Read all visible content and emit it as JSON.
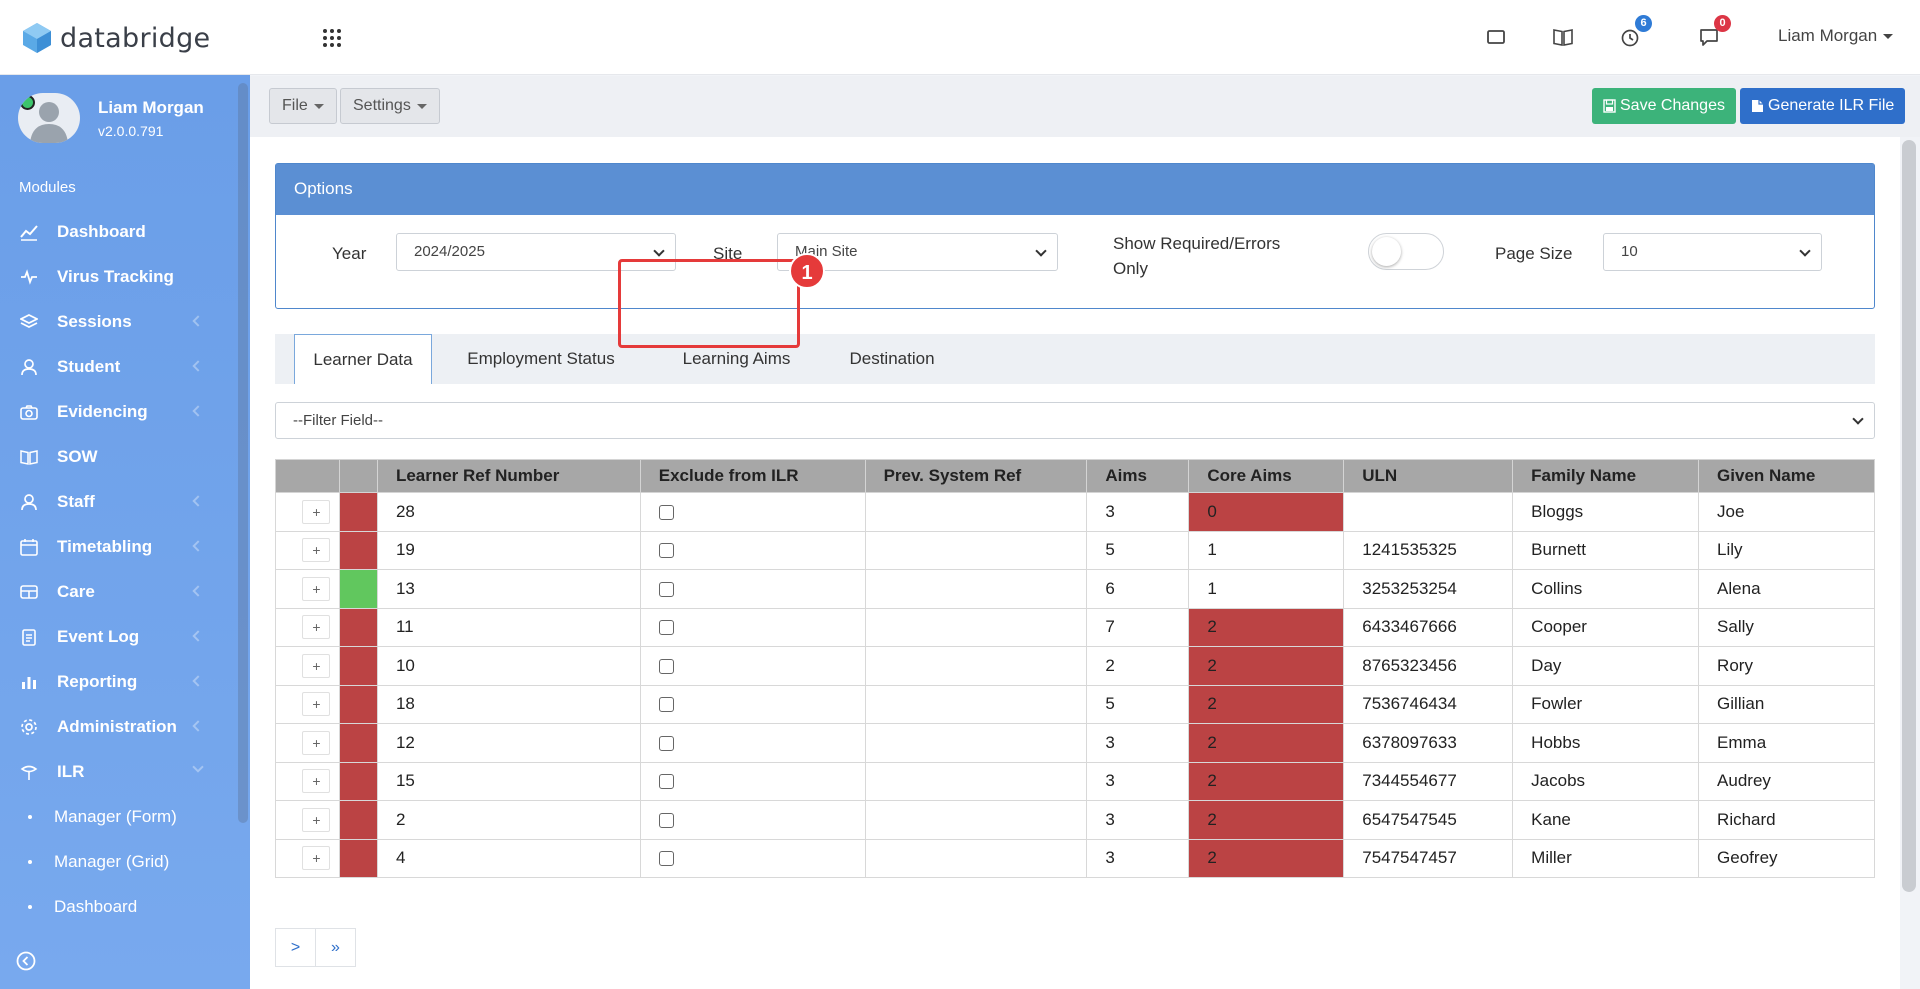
{
  "app": {
    "name": "databridge"
  },
  "header": {
    "user_name": "Liam Morgan",
    "reminders_count": "6",
    "messages_count": "0"
  },
  "sidebar": {
    "profile_name": "Liam Morgan",
    "version": "v2.0.0.791",
    "modules_label": "Modules",
    "items": [
      {
        "label": "Dashboard",
        "icon": "dashboard-chart-icon",
        "has_submenu": false
      },
      {
        "label": "Virus Tracking",
        "icon": "pulse-icon",
        "has_submenu": false
      },
      {
        "label": "Sessions",
        "icon": "layers-icon",
        "has_submenu": true
      },
      {
        "label": "Student",
        "icon": "student-icon",
        "has_submenu": true
      },
      {
        "label": "Evidencing",
        "icon": "camera-icon",
        "has_submenu": true
      },
      {
        "label": "SOW",
        "icon": "book-icon",
        "has_submenu": false
      },
      {
        "label": "Staff",
        "icon": "staff-icon",
        "has_submenu": true
      },
      {
        "label": "Timetabling",
        "icon": "calendar-icon",
        "has_submenu": true
      },
      {
        "label": "Care",
        "icon": "care-icon",
        "has_submenu": true
      },
      {
        "label": "Event Log",
        "icon": "clipboard-icon",
        "has_submenu": true
      },
      {
        "label": "Reporting",
        "icon": "bar-chart-icon",
        "has_submenu": true
      },
      {
        "label": "Administration",
        "icon": "gear-icon",
        "has_submenu": true
      },
      {
        "label": "ILR",
        "icon": "ilr-icon",
        "has_submenu": true
      }
    ],
    "subitems": [
      "Manager (Form)",
      "Manager (Grid)",
      "Dashboard"
    ]
  },
  "toolbar": {
    "file_label": "File",
    "settings_label": "Settings",
    "save_label": "Save Changes",
    "generate_label": "Generate ILR File"
  },
  "options": {
    "title": "Options",
    "year_label": "Year",
    "year_value": "2024/2025",
    "site_label": "Site",
    "site_value": "Main Site",
    "show_required_label_line1": "Show Required/Errors",
    "show_required_label_line2": "Only",
    "show_required_on": false,
    "page_size_label": "Page Size",
    "page_size_value": "10"
  },
  "tabs": [
    {
      "label": "Learner Data",
      "active": true
    },
    {
      "label": "Employment Status",
      "active": false
    },
    {
      "label": "Learning Aims",
      "active": false
    },
    {
      "label": "Destination",
      "active": false
    }
  ],
  "annotation": {
    "step": "1"
  },
  "filter": {
    "placeholder": "--Filter Field--"
  },
  "table": {
    "headers": [
      "",
      "",
      "Learner Ref Number",
      "Exclude from ILR",
      "Prev. System Ref",
      "Aims",
      "Core Aims",
      "ULN",
      "Family Name",
      "Given Name"
    ],
    "rows": [
      {
        "status": "red",
        "ref": "28",
        "prev": "",
        "aims": "3",
        "core": "0",
        "core_flag": true,
        "uln": "",
        "family": "Bloggs",
        "given": "Joe"
      },
      {
        "status": "red",
        "ref": "19",
        "prev": "",
        "aims": "5",
        "core": "1",
        "core_flag": false,
        "uln": "1241535325",
        "family": "Burnett",
        "given": "Lily"
      },
      {
        "status": "green",
        "ref": "13",
        "prev": "",
        "aims": "6",
        "core": "1",
        "core_flag": false,
        "uln": "3253253254",
        "family": "Collins",
        "given": "Alena"
      },
      {
        "status": "red",
        "ref": "11",
        "prev": "",
        "aims": "7",
        "core": "2",
        "core_flag": true,
        "uln": "6433467666",
        "family": "Cooper",
        "given": "Sally"
      },
      {
        "status": "red",
        "ref": "10",
        "prev": "",
        "aims": "2",
        "core": "2",
        "core_flag": true,
        "uln": "8765323456",
        "family": "Day",
        "given": "Rory"
      },
      {
        "status": "red",
        "ref": "18",
        "prev": "",
        "aims": "5",
        "core": "2",
        "core_flag": true,
        "uln": "7536746434",
        "family": "Fowler",
        "given": "Gillian"
      },
      {
        "status": "red",
        "ref": "12",
        "prev": "",
        "aims": "3",
        "core": "2",
        "core_flag": true,
        "uln": "6378097633",
        "family": "Hobbs",
        "given": "Emma"
      },
      {
        "status": "red",
        "ref": "15",
        "prev": "",
        "aims": "3",
        "core": "2",
        "core_flag": true,
        "uln": "7344554677",
        "family": "Jacobs",
        "given": "Audrey"
      },
      {
        "status": "red",
        "ref": "2",
        "prev": "",
        "aims": "3",
        "core": "2",
        "core_flag": true,
        "uln": "6547547545",
        "family": "Kane",
        "given": "Richard"
      },
      {
        "status": "red",
        "ref": "4",
        "prev": "",
        "aims": "3",
        "core": "2",
        "core_flag": true,
        "uln": "7547547457",
        "family": "Miller",
        "given": "Geofrey"
      }
    ],
    "expand_label": "+"
  },
  "pager": {
    "next_label": ">",
    "last_label": "»"
  },
  "colors": {
    "sidebar": "#6a9ee8",
    "options_header": "#5b8fd3",
    "error_cell": "#bb4344",
    "ok_cell": "#61c75e",
    "save_button": "#3cb37a",
    "generate_button": "#2f6fca",
    "highlight": "#e53a3a"
  }
}
